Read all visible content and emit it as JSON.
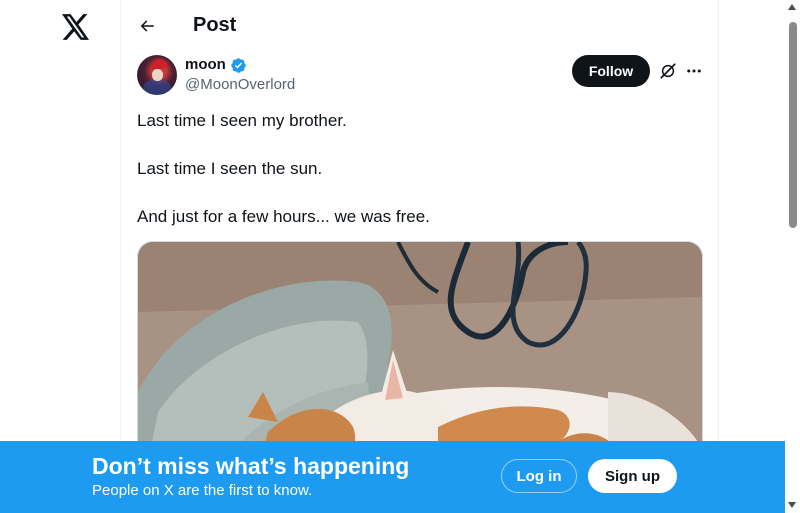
{
  "sidebar": {
    "logo_icon": "x-logo-icon"
  },
  "header": {
    "back_icon": "arrow-left-icon",
    "title": "Post"
  },
  "post": {
    "author": {
      "display_name": "moon",
      "handle": "@MoonOverlord",
      "verified": true,
      "verified_icon": "verified-badge-icon"
    },
    "follow_label": "Follow",
    "grok_icon": "grok-icon",
    "more_icon": "more-horizontal-icon",
    "text_lines": [
      "Last time I seen my brother.",
      "Last time I seen the sun.",
      "And just for a few hours... we was free."
    ],
    "media": {
      "kind": "photo",
      "subject": "cat-sleeping-photo"
    }
  },
  "login_banner": {
    "title": "Don’t miss what’s happening",
    "subtitle": "People on X are the first to know.",
    "login_label": "Log in",
    "signup_label": "Sign up"
  },
  "colors": {
    "accent": "#1d9bf0",
    "text": "#0f1419",
    "secondary_text": "#536471",
    "follow_bg": "#0f1419"
  }
}
